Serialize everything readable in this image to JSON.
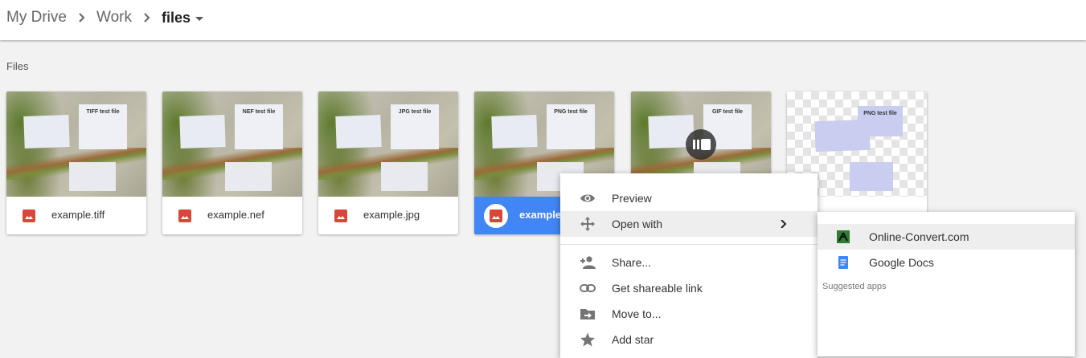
{
  "breadcrumb": {
    "items": [
      "My Drive",
      "Work"
    ],
    "current": "files"
  },
  "section_label": "Files",
  "files": [
    {
      "name": "example.tiff",
      "thumb_title": "TIFF test file"
    },
    {
      "name": "example.nef",
      "thumb_title": "NEF test file"
    },
    {
      "name": "example.jpg",
      "thumb_title": "JPG test file"
    },
    {
      "name": "example.",
      "thumb_title": "PNG test file",
      "selected": true
    },
    {
      "name": "",
      "thumb_title": "GIF test file"
    },
    {
      "name": "",
      "thumb_title": "PNG test file"
    }
  ],
  "context_menu": {
    "items": [
      {
        "label": "Preview",
        "icon": "eye-icon"
      },
      {
        "label": "Open with",
        "icon": "move-arrows-icon",
        "has_submenu": true
      },
      {
        "label": "Share...",
        "icon": "person-add-icon"
      },
      {
        "label": "Get shareable link",
        "icon": "link-icon"
      },
      {
        "label": "Move to...",
        "icon": "folder-move-icon"
      },
      {
        "label": "Add star",
        "icon": "star-icon"
      }
    ]
  },
  "open_with_submenu": {
    "apps": [
      {
        "label": "Online-Convert.com",
        "icon": "online-convert-icon"
      },
      {
        "label": "Google Docs",
        "icon": "google-docs-icon"
      }
    ],
    "section_label": "Suggested apps"
  },
  "colors": {
    "selected": "#4285f4",
    "image_icon": "#d9463a",
    "docs_icon": "#4285f4",
    "online_convert_icon": "#2e7d32"
  }
}
